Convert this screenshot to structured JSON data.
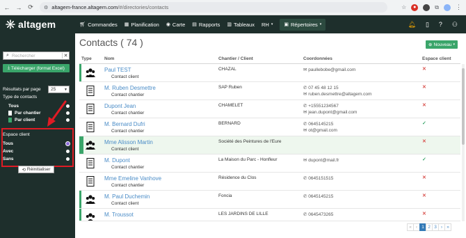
{
  "browser": {
    "url_host": "altagem-france.altagem.com",
    "url_path": "/#/directories/contacts"
  },
  "header": {
    "logo_text": "altagem",
    "menu": [
      {
        "label": "Commandes",
        "icon": "cart-icon"
      },
      {
        "label": "Planification",
        "icon": "calendar-icon"
      },
      {
        "label": "Carte",
        "icon": "map-pin-icon"
      },
      {
        "label": "Rapports",
        "icon": "report-icon"
      },
      {
        "label": "Tableaux",
        "icon": "table-icon"
      },
      {
        "label": "RH",
        "icon": ""
      },
      {
        "label": "Répertoires",
        "icon": "book-icon"
      }
    ]
  },
  "sidebar": {
    "search_placeholder": "Rechercher",
    "excel_label": "Télécharger (format Excel)",
    "per_page_label": "Résultats par page",
    "per_page_value": "25",
    "type_label": "Type de contacts",
    "types": [
      {
        "label": "Tous",
        "swatch": "",
        "selected": false
      },
      {
        "label": "Par chantier",
        "swatch": "#ffffff",
        "selected": false
      },
      {
        "label": "Par client",
        "swatch": "#3aa56a",
        "selected": false
      }
    ],
    "espace_label": "Espace client",
    "espace_options": [
      {
        "label": "Tous",
        "selected": true
      },
      {
        "label": "Avec",
        "selected": false
      },
      {
        "label": "Sans",
        "selected": false
      }
    ],
    "reset_label": "Réinitialiser"
  },
  "main": {
    "title": "Contacts ( 74 )",
    "new_label": "Nouveau",
    "columns": {
      "type": "Type",
      "name": "Nom",
      "chantier": "Chantier / Client",
      "coord": "Coordonnées",
      "espace": "Espace client"
    },
    "rows": [
      {
        "name": "Paul TEST",
        "sub": "Contact client",
        "chantier": "CHAZAL",
        "coord1": "✉ paullebobe@gmail.com",
        "coord2": "",
        "status": "x",
        "kind": "client"
      },
      {
        "name": "M. Ruben Desmettre",
        "sub": "Contact chantier",
        "chantier": "SAP Ruben",
        "coord1": "✆ 07 45 48 12 15",
        "coord2": "✉ ruben.desmettre@altagem.com",
        "status": "x",
        "kind": "chantier"
      },
      {
        "name": "Dupont Jean",
        "sub": "Contact chantier",
        "chantier": "CHAMELET",
        "coord1": "✆ +15551234567",
        "coord2": "✉ jean.dupont@gmail.com",
        "status": "x",
        "kind": "chantier"
      },
      {
        "name": "M. Bernard Dufri",
        "sub": "Contact chantier",
        "chantier": "BERNARD",
        "coord1": "✆ 0645145215",
        "coord2": "✉ ot@gmail.com",
        "status": "ok",
        "kind": "chantier"
      },
      {
        "name": "Mme Alisson Martin",
        "sub": "Contact client",
        "chantier": "Société des Peintures de l'Eure",
        "coord1": "",
        "coord2": "",
        "status": "x",
        "kind": "client",
        "highlight": true
      },
      {
        "name": "M. Dupont",
        "sub": "Contact chantier",
        "chantier": "La Maison du Parc - Honfleur",
        "coord1": "✉ dupont@mail.fr",
        "coord2": "",
        "status": "ok",
        "kind": "chantier"
      },
      {
        "name": "Mme Emeline Vanhove",
        "sub": "Contact chantier",
        "chantier": "Résidence du Clos",
        "coord1": "✆ 0645151515",
        "coord2": "",
        "status": "x",
        "kind": "chantier"
      },
      {
        "name": "M. Paul Duchemin",
        "sub": "Contact client",
        "chantier": "Foncia",
        "coord1": "✆ 0645145215",
        "coord2": "",
        "status": "x",
        "kind": "client"
      },
      {
        "name": "M. Troussot",
        "sub": "",
        "chantier": "LES JARDINS DE LILLE",
        "coord1": "✆ 0645473265",
        "coord2": "",
        "status": "x",
        "kind": "client"
      }
    ],
    "pagination": [
      "«",
      "‹",
      "1",
      "2",
      "3",
      "›",
      "»"
    ]
  },
  "colors": {
    "dark": "#1e2f2c",
    "green": "#3aa56a",
    "link": "#4a8cc7",
    "red": "#d9534f"
  }
}
